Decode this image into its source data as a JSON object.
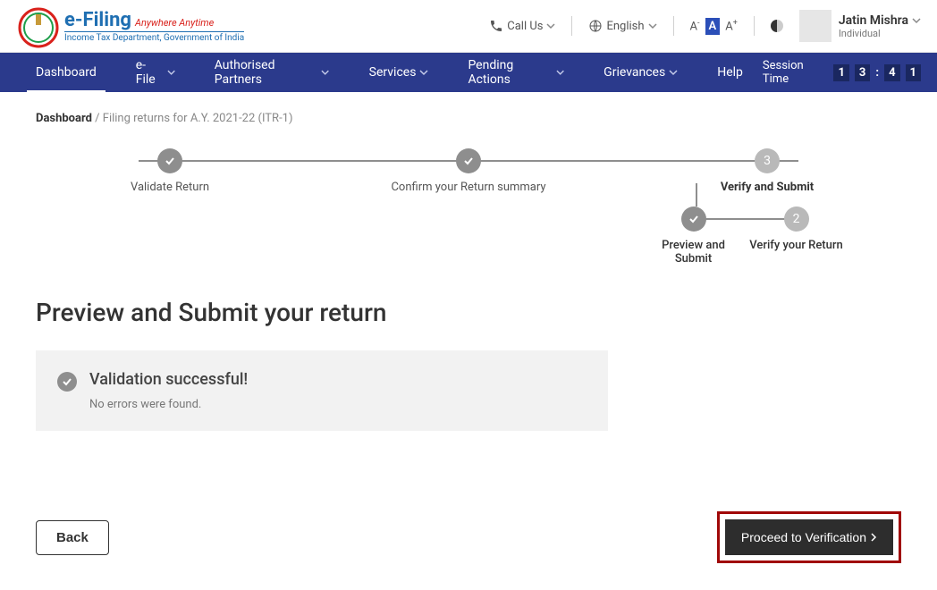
{
  "brand": {
    "title": "e‑Filing",
    "tagline": "Anywhere Anytime",
    "dept": "Income Tax Department, Government of India"
  },
  "top": {
    "call": "Call Us",
    "lang": "English",
    "font_dec": "A",
    "font_normal": "A",
    "font_inc": "A"
  },
  "user": {
    "name": "Jatin Mishra",
    "role": "Individual"
  },
  "nav": {
    "items": [
      "Dashboard",
      "e-File",
      "Authorised Partners",
      "Services",
      "Pending Actions",
      "Grievances",
      "Help"
    ],
    "session_label": "Session Time",
    "session_digits": [
      "1",
      "3",
      ":",
      "4",
      "1"
    ]
  },
  "breadcrumb": {
    "root": "Dashboard",
    "trail": "/ Filing returns for A.Y. 2021-22 (ITR-1)"
  },
  "stepper": {
    "main": [
      {
        "label": "Validate Return",
        "state": "done"
      },
      {
        "label": "Confirm your Return summary",
        "state": "done"
      },
      {
        "label": "Verify and Submit",
        "state": "current",
        "num": "3"
      }
    ],
    "sub": [
      {
        "label": "Preview and Submit",
        "state": "done"
      },
      {
        "label": "Verify your Return",
        "state": "pending",
        "num": "2"
      }
    ]
  },
  "page_title": "Preview and Submit your return",
  "card": {
    "title": "Validation successful!",
    "sub": "No errors were found."
  },
  "buttons": {
    "back": "Back",
    "proceed": "Proceed to Verification"
  }
}
